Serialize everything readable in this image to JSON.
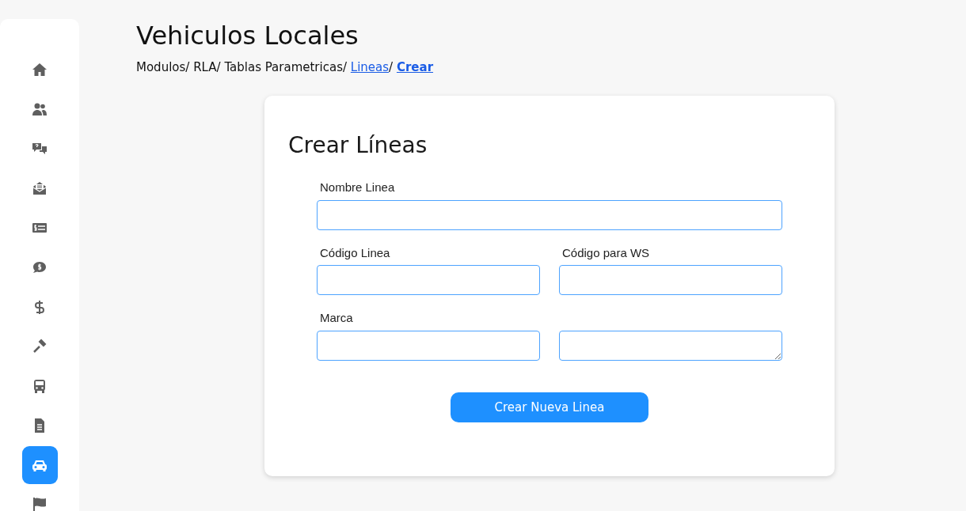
{
  "sidebar": {
    "items": [
      {
        "selected": false
      },
      {
        "selected": false
      },
      {
        "selected": false
      },
      {
        "selected": false
      },
      {
        "selected": false
      },
      {
        "selected": false
      },
      {
        "selected": false
      },
      {
        "selected": false
      },
      {
        "selected": false
      },
      {
        "selected": false
      },
      {
        "selected": true
      },
      {
        "selected": false
      }
    ]
  },
  "header": {
    "title": "Vehiculos Locales",
    "separator": "/",
    "breadcrumb": [
      {
        "text": "Modulos",
        "kind": "text"
      },
      {
        "text": "RLA",
        "kind": "text"
      },
      {
        "text": "Tablas Parametricas",
        "kind": "text"
      },
      {
        "text": "Lineas",
        "kind": "link"
      },
      {
        "text": "Crear",
        "kind": "current"
      }
    ]
  },
  "form": {
    "title": "Crear Líneas",
    "rows": [
      [
        {
          "label": "Nombre Linea",
          "kind": "input"
        }
      ],
      [
        {
          "label": "Código Linea",
          "kind": "input"
        },
        {
          "label": "Código para WS",
          "kind": "input"
        }
      ],
      [
        {
          "label": "Marca",
          "kind": "input"
        },
        {
          "kind": "textarea"
        }
      ]
    ],
    "submit": "Crear Nueva Linea"
  }
}
